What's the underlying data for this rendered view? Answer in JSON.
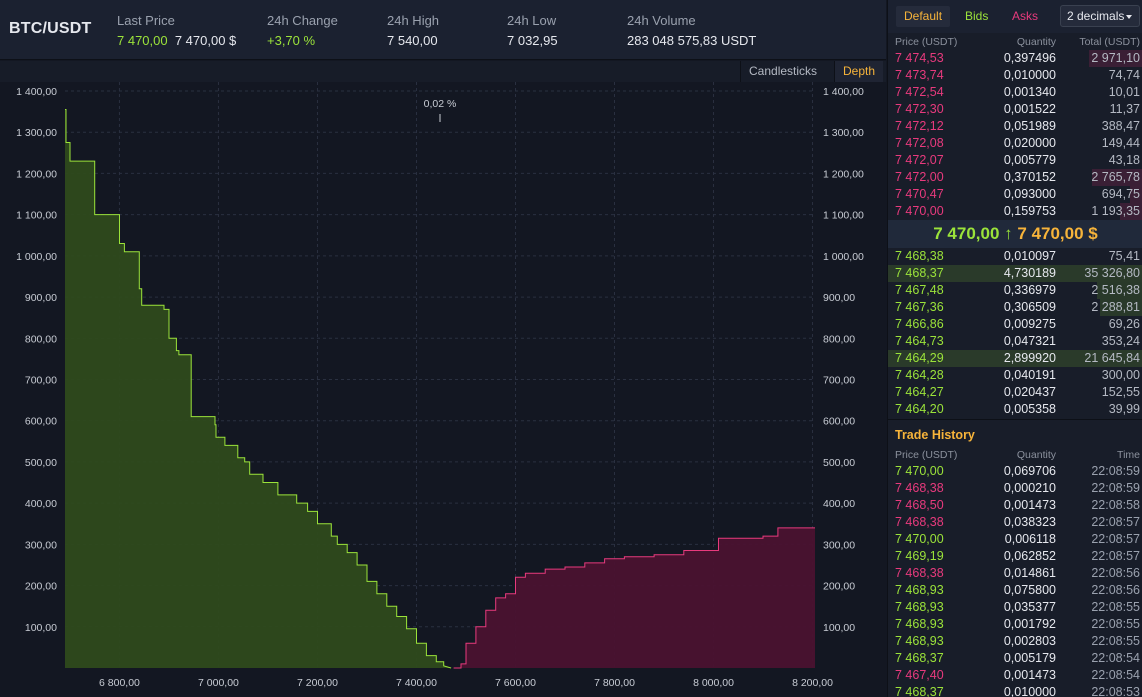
{
  "ticker": {
    "pair": "BTC/USDT",
    "last_price_label": "Last Price",
    "last_price": "7 470,00",
    "last_price_usd": "7 470,00 $",
    "change_label": "24h Change",
    "change": "+3,70 %",
    "high_label": "24h High",
    "high": "7 540,00",
    "low_label": "24h Low",
    "low": "7 032,95",
    "volume_label": "24h Volume",
    "volume": "283 048 575,83 USDT"
  },
  "chart_toolbar": {
    "candlesticks": "Candlesticks",
    "depth": "Depth",
    "active": "Depth"
  },
  "chart_data": {
    "type": "area",
    "mid_label": "0,02 %",
    "x_ticks": [
      "6 800,00",
      "7 000,00",
      "7 200,00",
      "7 400,00",
      "7 600,00",
      "7 800,00",
      "8 000,00",
      "8 200,00"
    ],
    "x_tick_values": [
      6800,
      7000,
      7200,
      7400,
      7600,
      7800,
      8000,
      8200
    ],
    "y_ticks": [
      "100,00",
      "200,00",
      "300,00",
      "400,00",
      "500,00",
      "600,00",
      "700,00",
      "800,00",
      "900,00",
      "1 000,00",
      "1 100,00",
      "1 200,00",
      "1 300,00",
      "1 400,00"
    ],
    "y_tick_values": [
      100,
      200,
      300,
      400,
      500,
      600,
      700,
      800,
      900,
      1000,
      1100,
      1200,
      1300,
      1400
    ],
    "xlim": [
      6690,
      8205
    ],
    "ylim": [
      0,
      1400
    ],
    "grid": true,
    "colors": {
      "bids_fill": "#2e4a1c",
      "bids_line": "#9be33a",
      "asks_fill": "#4a1230",
      "asks_line": "#e83a7d",
      "grid": "#2a3040"
    },
    "series": [
      {
        "name": "Bids",
        "x": [
          6690,
          6692,
          6692,
          6700,
          6700,
          6750,
          6750,
          6800,
          6800,
          6810,
          6810,
          6840,
          6840,
          6845,
          6845,
          6890,
          6890,
          6900,
          6900,
          6915,
          6915,
          6920,
          6920,
          6945,
          6945,
          6993,
          6993,
          6995,
          6995,
          7013,
          7013,
          7039,
          7039,
          7053,
          7053,
          7063,
          7063,
          7090,
          7090,
          7120,
          7120,
          7158,
          7158,
          7180,
          7180,
          7200,
          7200,
          7228,
          7228,
          7240,
          7240,
          7260,
          7260,
          7280,
          7280,
          7300,
          7300,
          7320,
          7320,
          7340,
          7340,
          7360,
          7360,
          7380,
          7380,
          7400,
          7400,
          7420,
          7420,
          7440,
          7440,
          7455,
          7455,
          7470
        ],
        "y": [
          1355,
          1355,
          1275,
          1275,
          1230,
          1230,
          1100,
          1100,
          1030,
          1030,
          1010,
          1010,
          920,
          920,
          880,
          880,
          870,
          870,
          800,
          800,
          770,
          770,
          760,
          760,
          610,
          610,
          590,
          590,
          560,
          560,
          540,
          540,
          510,
          510,
          500,
          500,
          470,
          470,
          450,
          450,
          420,
          420,
          400,
          400,
          380,
          380,
          350,
          350,
          320,
          320,
          300,
          300,
          280,
          280,
          250,
          250,
          210,
          210,
          180,
          180,
          150,
          150,
          125,
          125,
          95,
          95,
          60,
          60,
          30,
          30,
          15,
          15,
          5,
          0
        ]
      },
      {
        "name": "Asks",
        "x": [
          7475,
          7490,
          7490,
          7500,
          7500,
          7520,
          7520,
          7540,
          7540,
          7560,
          7560,
          7580,
          7580,
          7600,
          7600,
          7620,
          7620,
          7660,
          7660,
          7700,
          7700,
          7740,
          7740,
          7780,
          7780,
          7820,
          7820,
          7880,
          7880,
          7940,
          7940,
          8010,
          8010,
          8100,
          8100,
          8130,
          8130,
          8205
        ],
        "y": [
          0,
          0,
          10,
          10,
          60,
          60,
          100,
          100,
          140,
          140,
          170,
          170,
          180,
          180,
          220,
          220,
          230,
          230,
          240,
          240,
          245,
          245,
          255,
          255,
          265,
          265,
          270,
          270,
          275,
          275,
          285,
          285,
          315,
          315,
          320,
          320,
          340,
          340
        ]
      }
    ]
  },
  "orderbook": {
    "tabs": [
      "Default",
      "Bids",
      "Asks"
    ],
    "active_tab": "Default",
    "decimals": "2 decimals",
    "headers": {
      "price": "Price (USDT)",
      "quantity": "Quantity",
      "total": "Total (USDT)"
    },
    "asks": [
      {
        "price": "7 474,53",
        "qty": "0,397496",
        "total": "2 971,10",
        "depth": 0.21
      },
      {
        "price": "7 473,74",
        "qty": "0,010000",
        "total": "74,74",
        "depth": 0.0
      },
      {
        "price": "7 472,54",
        "qty": "0,001340",
        "total": "10,01",
        "depth": 0.0
      },
      {
        "price": "7 472,30",
        "qty": "0,001522",
        "total": "11,37",
        "depth": 0.0
      },
      {
        "price": "7 472,12",
        "qty": "0,051989",
        "total": "388,47",
        "depth": 0.0
      },
      {
        "price": "7 472,08",
        "qty": "0,020000",
        "total": "149,44",
        "depth": 0.0
      },
      {
        "price": "7 472,07",
        "qty": "0,005779",
        "total": "43,18",
        "depth": 0.0
      },
      {
        "price": "7 472,00",
        "qty": "0,370152",
        "total": "2 765,78",
        "depth": 0.2
      },
      {
        "price": "7 470,47",
        "qty": "0,093000",
        "total": "694,75",
        "depth": 0.05
      },
      {
        "price": "7 470,00",
        "qty": "0,159753",
        "total": "1 193,35",
        "depth": 0.09
      }
    ],
    "last_price": "7 470,00",
    "last_price_usd": "7 470,00 $",
    "bids": [
      {
        "price": "7 468,38",
        "qty": "0,010097",
        "total": "75,41",
        "depth": 0.0
      },
      {
        "price": "7 468,37",
        "qty": "4,730189",
        "total": "35 326,80",
        "depth": 1.0,
        "highlight": true
      },
      {
        "price": "7 467,48",
        "qty": "0,336979",
        "total": "2 516,38",
        "depth": 0.18
      },
      {
        "price": "7 467,36",
        "qty": "0,306509",
        "total": "2 288,81",
        "depth": 0.17
      },
      {
        "price": "7 466,86",
        "qty": "0,009275",
        "total": "69,26",
        "depth": 0.0
      },
      {
        "price": "7 464,73",
        "qty": "0,047321",
        "total": "353,24",
        "depth": 0.0
      },
      {
        "price": "7 464,29",
        "qty": "2,899920",
        "total": "21 645,84",
        "depth": 1.0,
        "highlight": true
      },
      {
        "price": "7 464,28",
        "qty": "0,040191",
        "total": "300,00",
        "depth": 0.0
      },
      {
        "price": "7 464,27",
        "qty": "0,020437",
        "total": "152,55",
        "depth": 0.0
      },
      {
        "price": "7 464,20",
        "qty": "0,005358",
        "total": "39,99",
        "depth": 0.0
      }
    ]
  },
  "trade_history": {
    "title": "Trade History",
    "headers": {
      "price": "Price (USDT)",
      "quantity": "Quantity",
      "time": "Time"
    },
    "trades": [
      {
        "price": "7 470,00",
        "qty": "0,069706",
        "time": "22:08:59",
        "side": "buy"
      },
      {
        "price": "7 468,38",
        "qty": "0,000210",
        "time": "22:08:59",
        "side": "sell"
      },
      {
        "price": "7 468,50",
        "qty": "0,001473",
        "time": "22:08:58",
        "side": "sell"
      },
      {
        "price": "7 468,38",
        "qty": "0,038323",
        "time": "22:08:57",
        "side": "sell"
      },
      {
        "price": "7 470,00",
        "qty": "0,006118",
        "time": "22:08:57",
        "side": "buy"
      },
      {
        "price": "7 469,19",
        "qty": "0,062852",
        "time": "22:08:57",
        "side": "buy"
      },
      {
        "price": "7 468,38",
        "qty": "0,014861",
        "time": "22:08:56",
        "side": "sell"
      },
      {
        "price": "7 468,93",
        "qty": "0,075800",
        "time": "22:08:56",
        "side": "buy"
      },
      {
        "price": "7 468,93",
        "qty": "0,035377",
        "time": "22:08:55",
        "side": "buy"
      },
      {
        "price": "7 468,93",
        "qty": "0,001792",
        "time": "22:08:55",
        "side": "buy"
      },
      {
        "price": "7 468,93",
        "qty": "0,002803",
        "time": "22:08:55",
        "side": "buy"
      },
      {
        "price": "7 468,37",
        "qty": "0,005179",
        "time": "22:08:54",
        "side": "buy"
      },
      {
        "price": "7 467,40",
        "qty": "0,001473",
        "time": "22:08:54",
        "side": "sell"
      },
      {
        "price": "7 468,37",
        "qty": "0,010000",
        "time": "22:08:53",
        "side": "buy"
      }
    ]
  }
}
